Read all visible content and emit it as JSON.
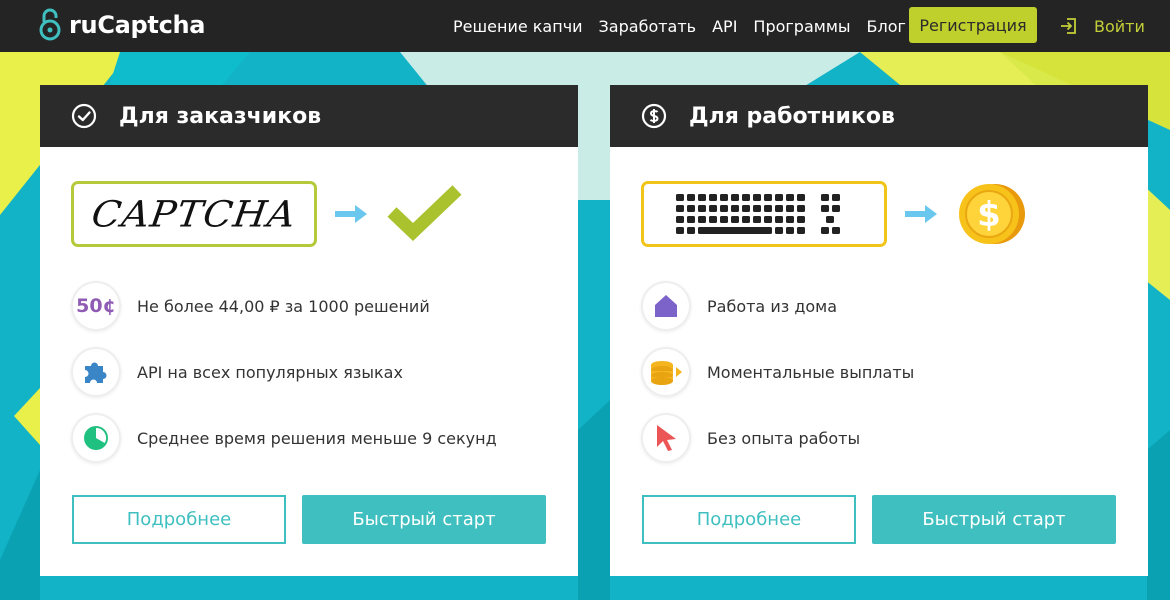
{
  "header": {
    "brand": "ruCaptcha",
    "nav": [
      {
        "label": "Решение капчи"
      },
      {
        "label": "Заработать"
      },
      {
        "label": "API"
      },
      {
        "label": "Программы"
      },
      {
        "label": "Блог"
      }
    ],
    "register_label": "Регистрация",
    "login_label": "Войти"
  },
  "customers": {
    "title": "Для заказчиков",
    "captcha_text": "CAPTCHA",
    "price_badge": "50¢",
    "features": [
      {
        "text": "Не более 44,00 ₽ за 1000 решений",
        "icon": "price-badge-icon"
      },
      {
        "text": "API на всех популярных языках",
        "icon": "puzzle-icon"
      },
      {
        "text": "Среднее время решения меньше 9 секунд",
        "icon": "timer-icon"
      }
    ],
    "more_label": "Подробнее",
    "start_label": "Быстрый старт"
  },
  "workers": {
    "title": "Для работников",
    "features": [
      {
        "text": "Работа из дома",
        "icon": "home-icon"
      },
      {
        "text": "Моментальные выплаты",
        "icon": "coins-icon"
      },
      {
        "text": "Без опыта работы",
        "icon": "cursor-icon"
      }
    ],
    "more_label": "Подробнее",
    "start_label": "Быстрый старт"
  },
  "colors": {
    "accent": "#bfcf2c",
    "teal": "#3fbfbf",
    "dark": "#2b2b2b"
  }
}
